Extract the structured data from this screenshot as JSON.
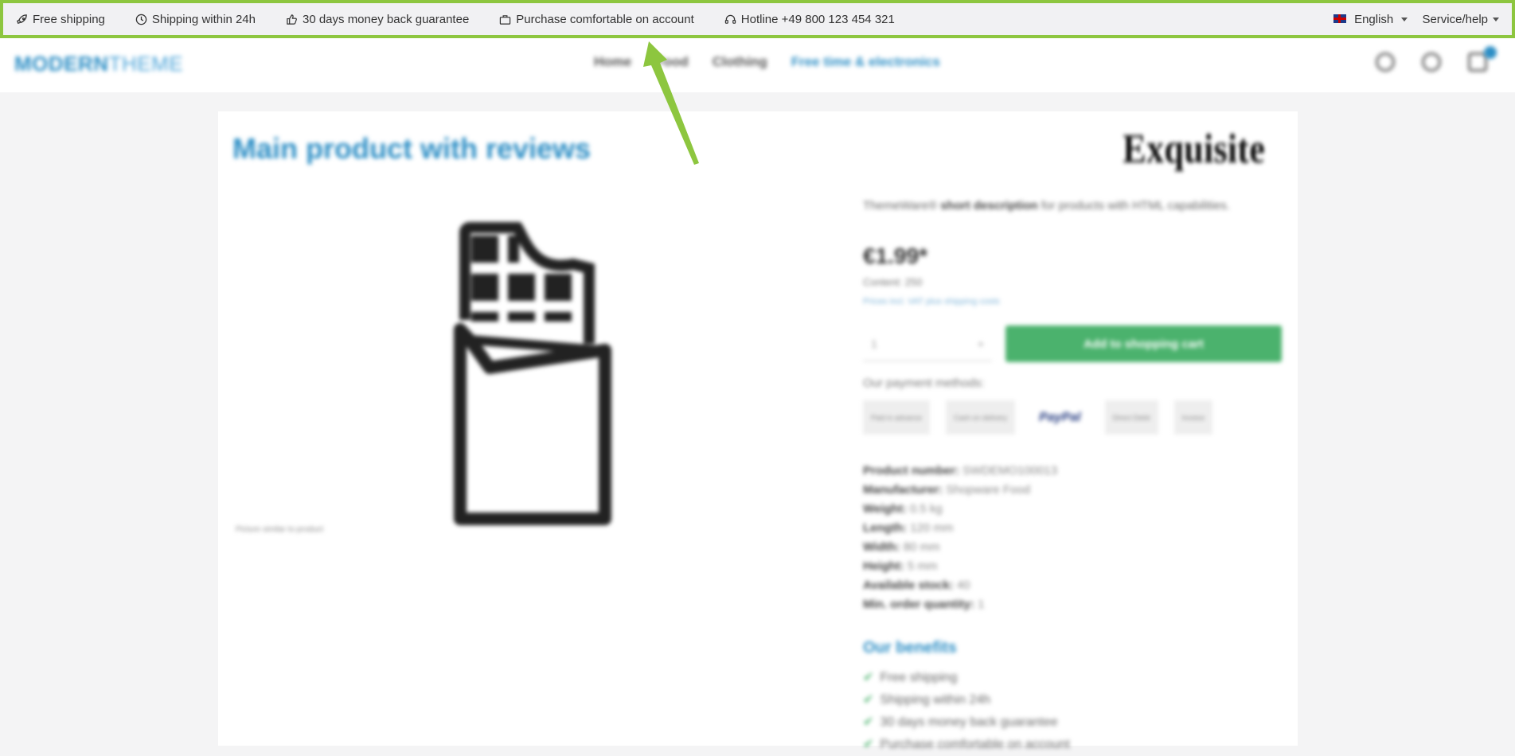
{
  "topbar": {
    "usps": [
      {
        "icon": "rocket-icon",
        "label": "Free shipping"
      },
      {
        "icon": "clock-icon",
        "label": "Shipping within 24h"
      },
      {
        "icon": "thumbs-up-icon",
        "label": "30 days money back guarantee"
      },
      {
        "icon": "briefcase-icon",
        "label": "Purchase comfortable on account"
      },
      {
        "icon": "headset-icon",
        "label": "Hotline +49 800 123 454 321"
      }
    ],
    "language": "English",
    "service": "Service/help"
  },
  "header": {
    "logo_part1": "MODERN",
    "logo_part2": "THEME",
    "nav": [
      "Home",
      "Food",
      "Clothing",
      "Free time & electronics"
    ],
    "cart_count": ""
  },
  "product": {
    "title": "Main product with reviews",
    "brand": "Exquisite",
    "image_caption": "Picture similar to product",
    "short_desc_prefix": "ThemeWare®",
    "short_desc_bold": "short description",
    "short_desc_suffix": "for products with HTML capabilities.",
    "price": "€1.99*",
    "content": "Content: 250",
    "vat": "Prices incl. VAT plus shipping costs",
    "quantity": "1",
    "add_to_cart": "Add to shopping cart",
    "payment_label": "Our payment methods:",
    "payment_methods": [
      "Paid in advance",
      "Cash on delivery",
      "PayPal",
      "Direct Debit",
      "Invoice"
    ],
    "specs": [
      {
        "k": "Product number:",
        "v": "SWDEMO100013"
      },
      {
        "k": "Manufacturer:",
        "v": "Shopware Food"
      },
      {
        "k": "Weight:",
        "v": "0.5 kg"
      },
      {
        "k": "Length:",
        "v": "120 mm"
      },
      {
        "k": "Width:",
        "v": "80 mm"
      },
      {
        "k": "Height:",
        "v": "5 mm"
      },
      {
        "k": "Available stock:",
        "v": "40"
      },
      {
        "k": "Min. order quantity:",
        "v": "1"
      }
    ],
    "benefits_title": "Our benefits",
    "benefits": [
      "Free shipping",
      "Shipping within 24h",
      "30 days money back guarantee",
      "Purchase comfortable on account"
    ]
  },
  "colors": {
    "accent": "#2c8ec5",
    "highlight": "#8dc63f",
    "buy": "#4bb26d"
  }
}
